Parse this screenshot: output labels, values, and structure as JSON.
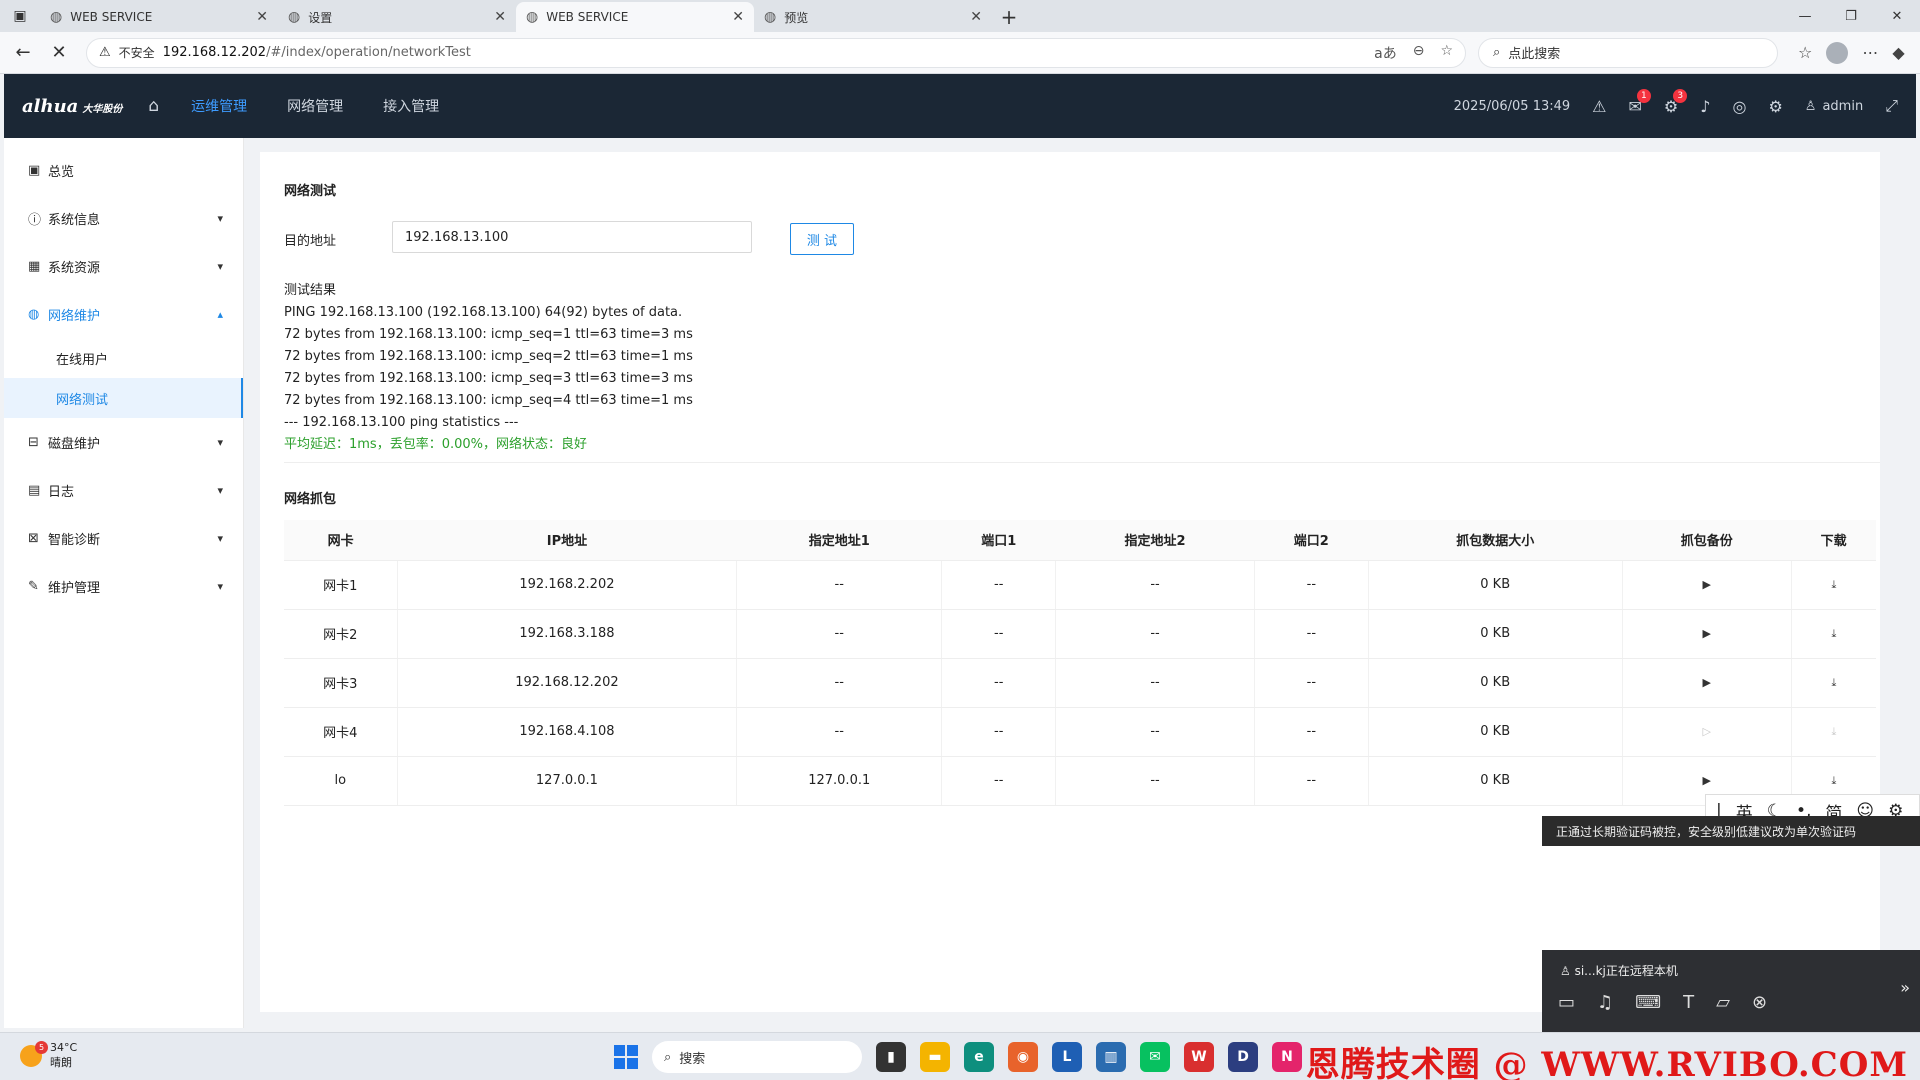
{
  "browser": {
    "tabs": [
      {
        "label": "WEB SERVICE",
        "active": false
      },
      {
        "label": "设置",
        "active": false
      },
      {
        "label": "WEB SERVICE",
        "active": true
      },
      {
        "label": "预览",
        "active": false
      }
    ],
    "insecure_label": "不安全",
    "url_host": "192.168.12.202",
    "url_path": "/#/index/operation/networkTest",
    "search_placeholder": "点此搜索"
  },
  "header": {
    "brand": "alhua",
    "brand_cn": "大华股份",
    "nav": [
      "运维管理",
      "网络管理",
      "接入管理"
    ],
    "active_nav": "运维管理",
    "datetime": "2025/06/05 13:49",
    "badges": {
      "messages": "1",
      "alerts": "3"
    },
    "user": "admin"
  },
  "sidebar": {
    "items": [
      {
        "label": "总览",
        "icon": "monitor-icon"
      },
      {
        "label": "系统信息",
        "icon": "info-icon"
      },
      {
        "label": "系统资源",
        "icon": "grid-icon"
      },
      {
        "label": "网络维护",
        "icon": "globe-icon"
      },
      {
        "label": "磁盘维护",
        "icon": "disk-icon"
      },
      {
        "label": "日志",
        "icon": "calendar-icon"
      },
      {
        "label": "智能诊断",
        "icon": "diagnosis-icon"
      },
      {
        "label": "维护管理",
        "icon": "wrench-icon"
      }
    ],
    "subitems": [
      {
        "label": "在线用户"
      },
      {
        "label": "网络测试"
      }
    ]
  },
  "network_test": {
    "title": "网络测试",
    "dest_label": "目的地址",
    "dest_value": "192.168.13.100",
    "test_button": "测 试",
    "result_title": "测试结果",
    "result_lines": [
      "PING 192.168.13.100 (192.168.13.100) 64(92) bytes of data.",
      "72 bytes from 192.168.13.100: icmp_seq=1 ttl=63 time=3 ms",
      "72 bytes from 192.168.13.100: icmp_seq=2 ttl=63 time=1 ms",
      "72 bytes from 192.168.13.100: icmp_seq=3 ttl=63 time=3 ms",
      "72 bytes from 192.168.13.100: icmp_seq=4 ttl=63 time=1 ms",
      "--- 192.168.13.100 ping statistics ---"
    ],
    "summary": "平均延迟：1ms，丢包率：0.00%，网络状态：良好"
  },
  "capture": {
    "title": "网络抓包",
    "columns": [
      "网卡",
      "IP地址",
      "指定地址1",
      "端口1",
      "指定地址2",
      "端口2",
      "抓包数据大小",
      "抓包备份",
      "下载"
    ],
    "rows": [
      {
        "nic": "网卡1",
        "ip": "192.168.2.202",
        "addr1": "--",
        "port1": "--",
        "addr2": "--",
        "port2": "--",
        "size": "0 KB",
        "enabled": true
      },
      {
        "nic": "网卡2",
        "ip": "192.168.3.188",
        "addr1": "--",
        "port1": "--",
        "addr2": "--",
        "port2": "--",
        "size": "0 KB",
        "enabled": true
      },
      {
        "nic": "网卡3",
        "ip": "192.168.12.202",
        "addr1": "--",
        "port1": "--",
        "addr2": "--",
        "port2": "--",
        "size": "0 KB",
        "enabled": true
      },
      {
        "nic": "网卡4",
        "ip": "192.168.4.108",
        "addr1": "--",
        "port1": "--",
        "addr2": "--",
        "port2": "--",
        "size": "0 KB",
        "enabled": false
      },
      {
        "nic": "lo",
        "ip": "127.0.0.1",
        "addr1": "127.0.0.1",
        "port1": "--",
        "addr2": "--",
        "port2": "--",
        "size": "0 KB",
        "enabled": true
      }
    ]
  },
  "overlays": {
    "ime": [
      "英",
      "简"
    ],
    "toast": "正通过长期验证码被控，安全级别低建议改为单次验证码",
    "remote_status": "si...kj正在远程本机"
  },
  "taskbar": {
    "temp": "34°C",
    "weather": "晴朗",
    "weather_badge": "5",
    "search": "搜索",
    "watermark": "恩腾技术圈 @ WWW.RVIBO.COM"
  },
  "colors": {
    "accent": "#1e88e5",
    "header_bg": "#1b2735",
    "success": "#2ca02c",
    "badge": "#f5333f"
  }
}
